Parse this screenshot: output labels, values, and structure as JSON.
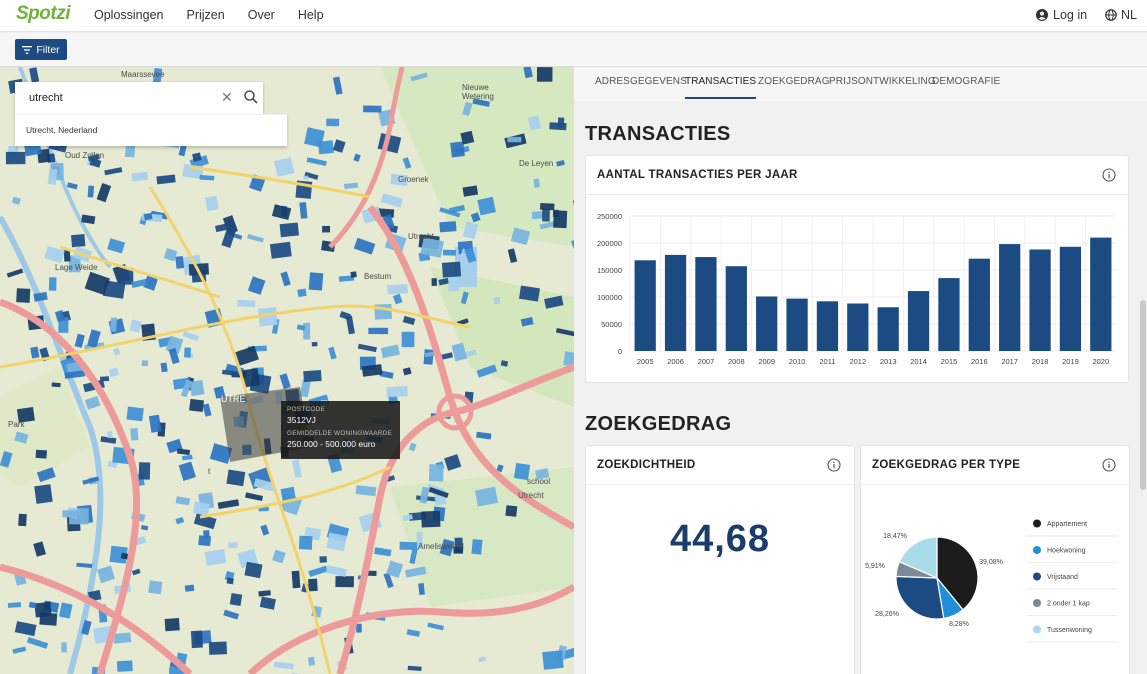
{
  "brand": {
    "logo": "Spotzi",
    "accent": "#6fb23c",
    "primary": "#1b4b82"
  },
  "nav": {
    "items": [
      "Oplossingen",
      "Prijzen",
      "Over",
      "Help"
    ],
    "login": "Log in",
    "language": "NL"
  },
  "filter": {
    "label": "Filter"
  },
  "map": {
    "search_value": "utrecht",
    "suggestion": "Utrecht, Nederland",
    "labels": [
      "Maarssevee",
      "Nieuwe Wetering",
      "Oud Zuilen",
      "Lage Weide",
      "Groenek",
      "De Leyen",
      "Utrecht",
      "Utrecht",
      "Bestum",
      "Park",
      "UTRE",
      "Amelisweerd",
      "t",
      "rsmade",
      "Utrecht",
      "school"
    ],
    "tooltip": {
      "postcode_label": "POSTCODE",
      "postcode_value": "3512VJ",
      "value_label": "GEMIDDELDE WONINGWAARDE",
      "value_value": "250.000 - 500.000 euro"
    }
  },
  "tabs": [
    "ADRESGEGEVENS",
    "TRANSACTIES",
    "ZOEKGEDRAG",
    "PRIJSONTWIKKELING",
    "DEMOGRAFIE"
  ],
  "active_tab": "TRANSACTIES",
  "sections": {
    "transacties": "TRANSACTIES",
    "zoekgedrag": "ZOEKGEDRAG"
  },
  "cards": {
    "transacties_per_jaar": "AANTAL TRANSACTIES PER JAAR",
    "zoekdichtheid": "ZOEKDICHTHEID",
    "zoekdichtheid_value": "44,68",
    "zoekgedrag_per_type": "ZOEKGEDRAG PER TYPE"
  },
  "chart_data": [
    {
      "type": "bar",
      "title": "AANTAL TRANSACTIES PER JAAR",
      "categories": [
        "2005",
        "2006",
        "2007",
        "2008",
        "2009",
        "2010",
        "2011",
        "2012",
        "2013",
        "2014",
        "2015",
        "2016",
        "2017",
        "2018",
        "2019",
        "2020"
      ],
      "values": [
        168000,
        178000,
        174000,
        157000,
        101000,
        97000,
        92000,
        88000,
        81000,
        111000,
        135000,
        171000,
        198000,
        188000,
        193000,
        210000
      ],
      "yticks": [
        "0",
        "50000",
        "100000",
        "150000",
        "200000",
        "250000"
      ],
      "ylim": [
        0,
        250000
      ],
      "grid": true,
      "bar_color": "#1b4b82"
    },
    {
      "type": "pie",
      "title": "ZOEKGEDRAG PER TYPE",
      "labels": [
        "Appartement",
        "Hoekwoning",
        "Vrijstaand",
        "2 onder 1 kap",
        "Tussenwoning"
      ],
      "values": [
        39.08,
        8.28,
        28.26,
        5.91,
        18.47
      ],
      "value_labels": [
        "39,08%",
        "8,28%",
        "28,26%",
        "5,91%",
        "18,47%"
      ],
      "colors": [
        "#1c1c1c",
        "#1f8fd6",
        "#1b4b82",
        "#7b8a94",
        "#a9dce8"
      ],
      "legend": "right"
    }
  ]
}
